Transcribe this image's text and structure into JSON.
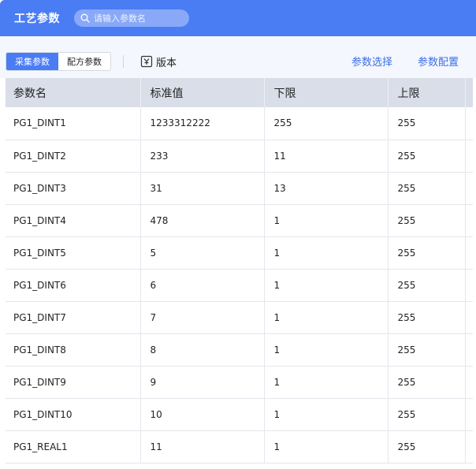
{
  "header": {
    "title": "工艺参数",
    "search_placeholder": "请输入参数名"
  },
  "toolbar": {
    "tabs": [
      {
        "label": "采集参数",
        "active": true
      },
      {
        "label": "配方参数",
        "active": false
      }
    ],
    "version_label": "版本",
    "param_select_label": "参数选择",
    "param_config_label": "参数配置"
  },
  "table": {
    "columns": [
      "参数名",
      "标准值",
      "下限",
      "上限"
    ],
    "rows": [
      [
        "PG1_DINT1",
        "1233312222",
        "255",
        "255"
      ],
      [
        "PG1_DINT2",
        "233",
        "11",
        "255"
      ],
      [
        "PG1_DINT3",
        "31",
        "13",
        "255"
      ],
      [
        "PG1_DINT4",
        "478",
        "1",
        "255"
      ],
      [
        "PG1_DINT5",
        "5",
        "1",
        "255"
      ],
      [
        "PG1_DINT6",
        "6",
        "1",
        "255"
      ],
      [
        "PG1_DINT7",
        "7",
        "1",
        "255"
      ],
      [
        "PG1_DINT8",
        "8",
        "1",
        "255"
      ],
      [
        "PG1_DINT9",
        "9",
        "1",
        "255"
      ],
      [
        "PG1_DINT10",
        "10",
        "1",
        "255"
      ],
      [
        "PG1_REAL1",
        "11",
        "1",
        "255"
      ]
    ]
  },
  "colors": {
    "accent": "#4a7cf4",
    "link": "#3c6fe6",
    "header_row_bg": "#d9dee8",
    "toolbar_bg": "#f4f7fd"
  },
  "icons": {
    "search": "search-icon",
    "version": "version-icon"
  }
}
